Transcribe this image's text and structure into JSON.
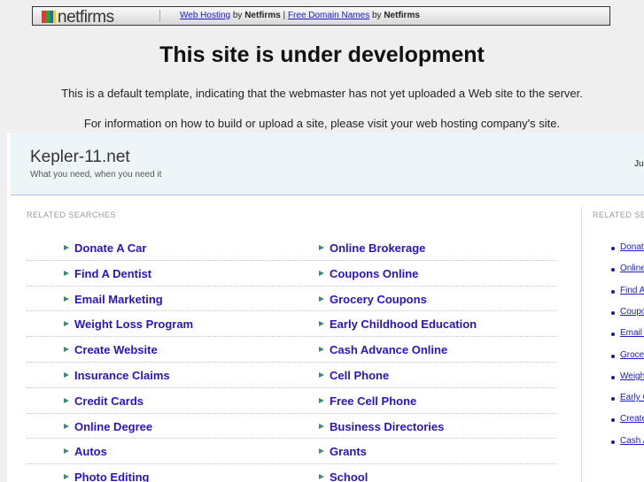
{
  "topbar": {
    "logo": "netfirms",
    "link1": "Web Hosting",
    "by1": " by ",
    "brand1": "Netfirms",
    "pipe": " | ",
    "link2": "Free Domain Names",
    "by2": " by ",
    "brand2": "Netfirms"
  },
  "title": "This site is under development",
  "msg1": "This is a default template, indicating that the webmaster has not yet uploaded a Web site to the server.",
  "msg2": "For information on how to build or upload a site, please visit your web hosting company's site.",
  "parked": {
    "site_name": "Kepler-11.net",
    "tagline": "What you need, when you need it",
    "date": "Ju",
    "related_label": "RELATED SEARCHES",
    "side_label": "RELATED SEARCHES",
    "left": [
      "Donate A Car",
      "Find A Dentist",
      "Email Marketing",
      "Weight Loss Program",
      "Create Website",
      "Insurance Claims",
      "Credit Cards",
      "Online Degree",
      "Autos",
      "Photo Editing"
    ],
    "right": [
      "Online Brokerage",
      "Coupons Online",
      "Grocery Coupons",
      "Early Childhood Education",
      "Cash Advance Online",
      "Cell Phone",
      "Free Cell Phone",
      "Business Directories",
      "Grants",
      "School"
    ],
    "side": [
      "Donate A Car",
      "Online Brokerage",
      "Find A Dentist",
      "Coupons Online",
      "Email Marketing",
      "Grocery Coupons",
      "Weight Loss Program",
      "Early Childhood Education",
      "Create Website",
      "Cash Advance Online"
    ]
  }
}
